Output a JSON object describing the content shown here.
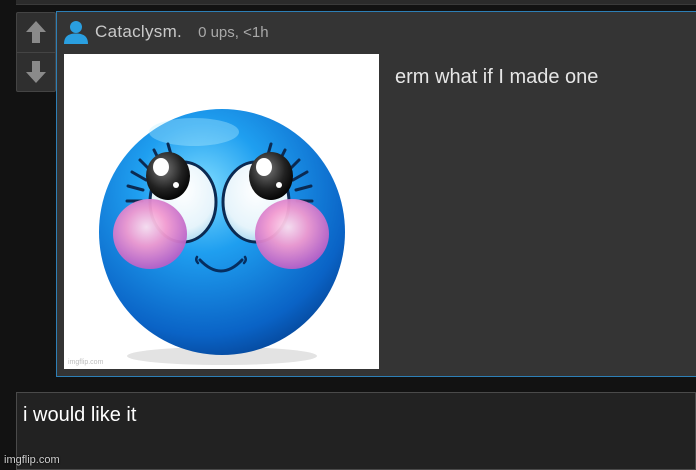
{
  "comment": {
    "username": "Cataclysm.",
    "meta": "0 ups, <1h",
    "text": "erm what if I made one",
    "image_watermark": "imgflip.com"
  },
  "reply": {
    "text": "i would like it"
  },
  "site_watermark": "imgflip.com",
  "icons": {
    "upvote": "arrow-up-icon",
    "downvote": "arrow-down-icon",
    "user": "user-icon"
  },
  "colors": {
    "page_background": "#121212",
    "comment_background": "#343434",
    "comment_border": "#2d7fb6",
    "user_icon": "#2a9fe0",
    "vote_arrow": "#8a8a8a"
  }
}
